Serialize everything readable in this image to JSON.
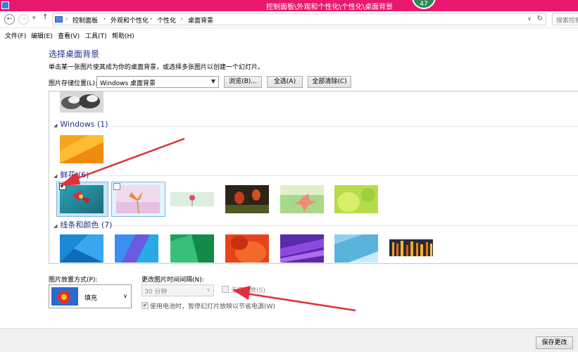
{
  "titlebar": {
    "title": "控制面板\\外观和个性化\\个性化\\桌面背景",
    "badge": "47",
    "app_icon": "control-panel-icon"
  },
  "addressbar": {
    "back": "←",
    "forward": "→",
    "recent": "▾",
    "up": "↑",
    "crumbs": [
      "控制面板",
      "外观和个性化",
      "个性化",
      "桌面背景"
    ],
    "separator": "›",
    "dropdown": "∨",
    "refresh": "↻",
    "search_placeholder": "搜索控制"
  },
  "menu": [
    "文件(F)",
    "编辑(E)",
    "查看(V)",
    "工具(T)",
    "帮助(H)"
  ],
  "page": {
    "heading": "选择桌面背景",
    "subtext": "单击某一张图片使其成为你的桌面背景，或选择多张图片以创建一个幻灯片。",
    "location_label": "图片存储位置(L):",
    "location_value": "Windows 桌面背景",
    "browse_button": "浏览(B)...",
    "select_all_button": "全选(A)",
    "clear_all_button": "全部清除(C)"
  },
  "gallery": {
    "groups": [
      {
        "name": "Windows (1)",
        "count": 1
      },
      {
        "name": "鲜花 (6)",
        "count": 6
      },
      {
        "name": "线条和颜色 (7)",
        "count": 7
      }
    ],
    "flowers_first_checked": true,
    "flowers_second_checked": false
  },
  "options": {
    "position_label": "图片放置方式(P):",
    "position_value": "填充",
    "interval_label": "更改图片时间间隔(N):",
    "interval_value": "30 分钟",
    "shuffle_label": "无序播放(S)",
    "shuffle_checked": false,
    "battery_label": "使用电池时，暂停幻灯片放映以节省电源(W)",
    "battery_checked": true
  },
  "footer": {
    "save_button": "保存更改"
  },
  "colors": {
    "titlebar": "#e8186e",
    "heading": "#1e3287",
    "annotation_arrow": "#e0303a",
    "selection": "#cce4f7"
  }
}
